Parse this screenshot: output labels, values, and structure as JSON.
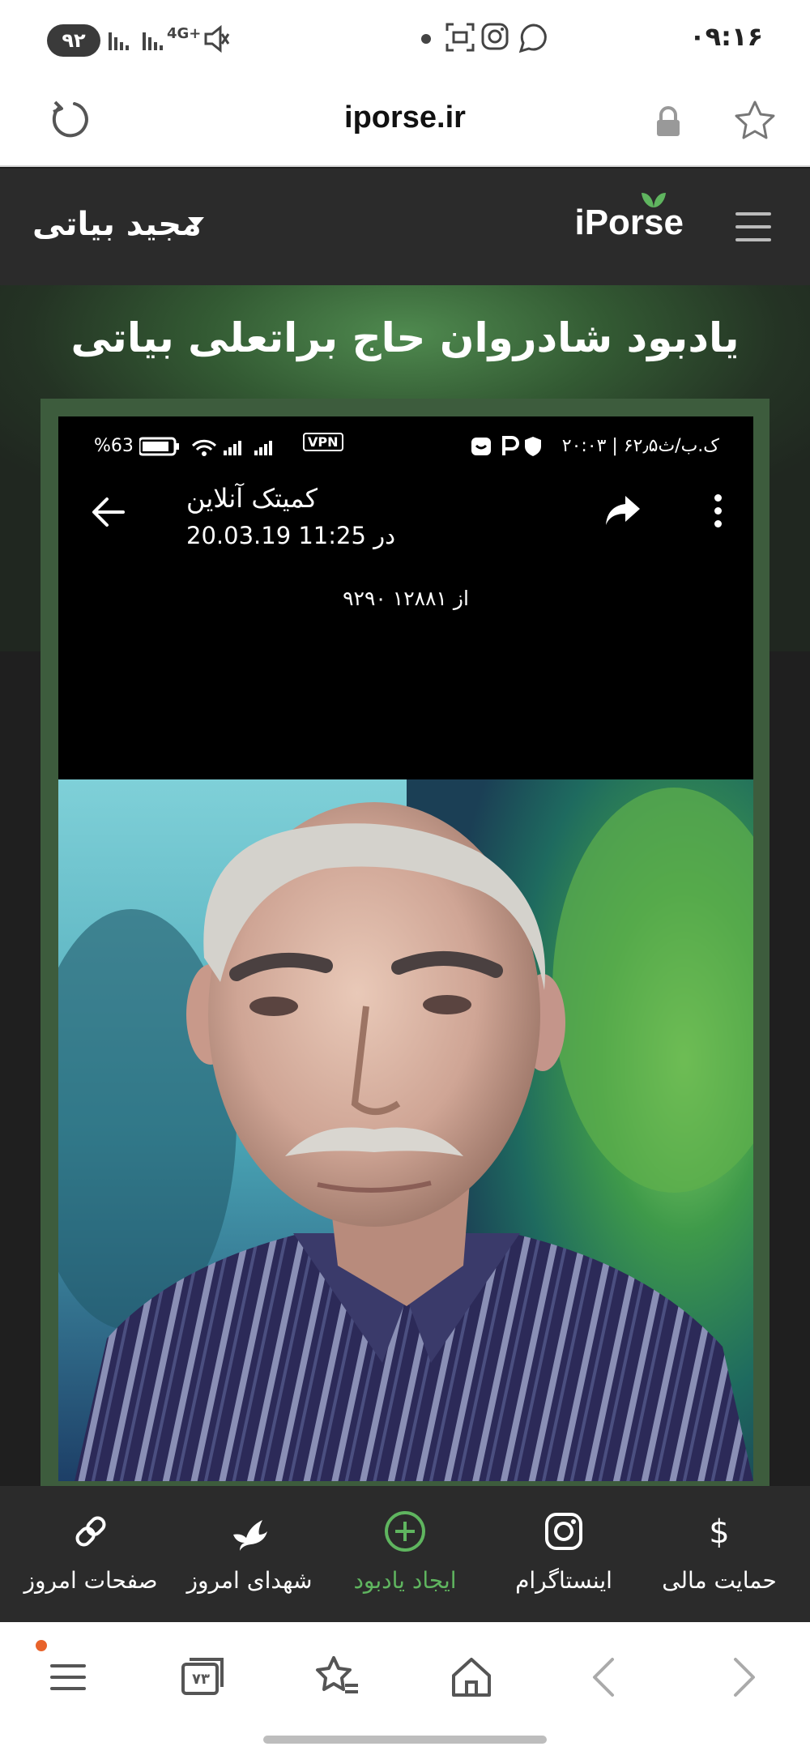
{
  "status_bar": {
    "battery": "۹۲",
    "network": "4G+",
    "time": "۰۹:۱۶"
  },
  "browser": {
    "url": "iporse.ir"
  },
  "site_header": {
    "username": "مجید بیاتی",
    "logo": "iPorse"
  },
  "hero": {
    "title": "یادبود شادروان حاج براتعلی بیاتی"
  },
  "post": {
    "status_battery": "%63",
    "status_vpn": "VPN",
    "status_right": "۲۰:۰۳ | ۶۲٫۵ک.ب/ث",
    "title": "کمیتک آنلاین",
    "subtitle": "20.03.19 در 11:25",
    "counter": "۹۲۹۰ از ۱۲۸۸۱"
  },
  "site_nav": {
    "items": [
      {
        "label": "حمایت مالی",
        "icon": "dollar-icon"
      },
      {
        "label": "اینستاگرام",
        "icon": "instagram-icon"
      },
      {
        "label": "ایجاد یادبود",
        "icon": "add-circle-icon",
        "color": "#5fb55f"
      },
      {
        "label": "شهدای امروز",
        "icon": "dove-icon"
      },
      {
        "label": "صفحات امروز",
        "icon": "link-icon"
      }
    ]
  },
  "browser_toolbar": {
    "tabs_count": "۷۳"
  },
  "colors": {
    "accent_green": "#5fb55f",
    "header_bg": "#2b2b2b"
  }
}
